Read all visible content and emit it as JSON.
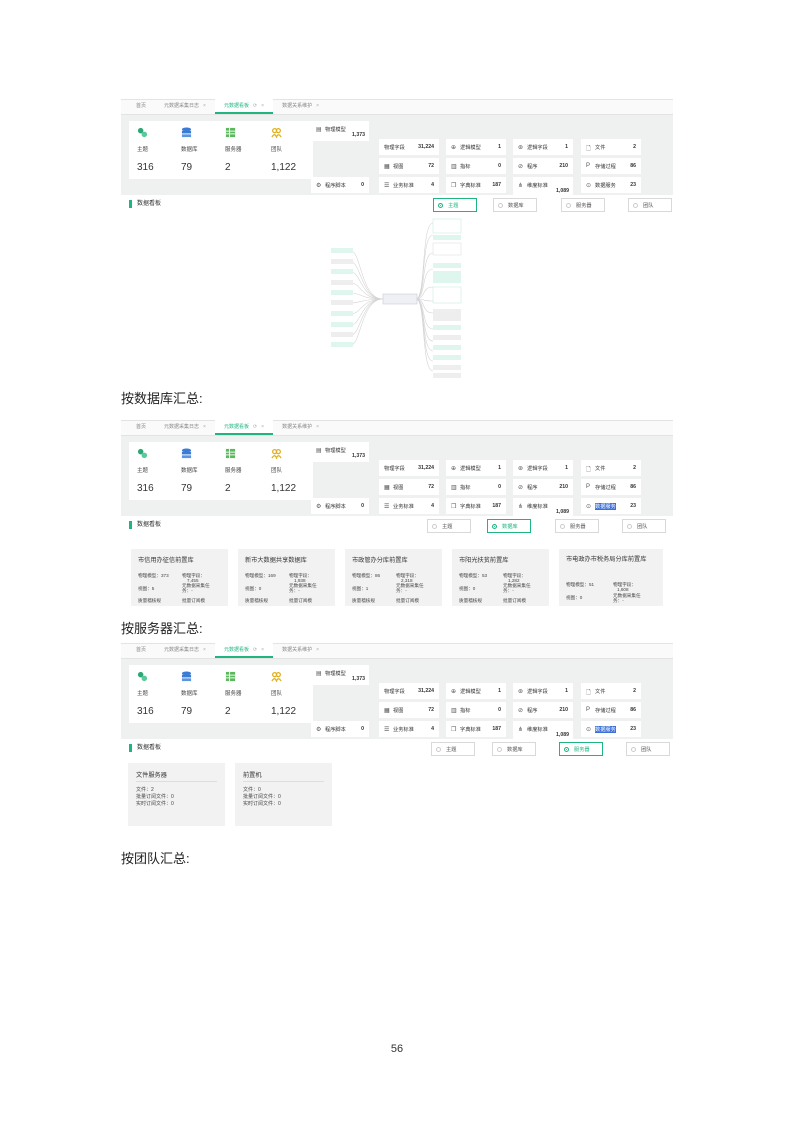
{
  "tabs": [
    {
      "label": "首页",
      "closable": false,
      "active": false
    },
    {
      "label": "元数据采集日志",
      "closable": true,
      "active": false
    },
    {
      "label": "元数据看板",
      "closable": true,
      "active": true
    },
    {
      "label": "数据关系维护",
      "closable": true,
      "active": false
    }
  ],
  "close_glyph": "×",
  "refresh_glyph": "⟳",
  "kpis": [
    {
      "label": "主题",
      "value": "316",
      "icon": "topic-icon",
      "color": "#2aa876"
    },
    {
      "label": "数据库",
      "value": "79",
      "icon": "database-icon",
      "color": "#3a7bd5"
    },
    {
      "label": "服务器",
      "value": "2",
      "icon": "server-icon",
      "color": "#5cb85c"
    },
    {
      "label": "团队",
      "value": "1,122",
      "icon": "team-icon",
      "color": "#e0b020"
    }
  ],
  "stats": {
    "physical_model": {
      "icon": "▤",
      "label": "物理模型",
      "value": "1,373"
    },
    "program_script": {
      "icon": "⚙",
      "label": "程序脚本",
      "value": "0"
    },
    "physical_field": {
      "label": "物理字段",
      "value": "31,224"
    },
    "view": {
      "icon": "▦",
      "label": "视图",
      "value": "72"
    },
    "business_std": {
      "icon": "☰",
      "label": "业务标准",
      "value": "4"
    },
    "logic_model": {
      "icon": "⊕",
      "label": "逻辑模型",
      "value": "1"
    },
    "metric": {
      "icon": "▥",
      "label": "指标",
      "value": "0"
    },
    "dict_std": {
      "icon": "❐",
      "label": "字典标准",
      "value": "187"
    },
    "logic_field": {
      "icon": "⊛",
      "label": "逻辑字段",
      "value": "1"
    },
    "program": {
      "icon": "⊘",
      "label": "程序",
      "value": "210"
    },
    "dimension_std": {
      "icon": "⋔",
      "label": "维度标准",
      "value": "1,089"
    },
    "file": {
      "icon": "🗋",
      "label": "文件",
      "value": "2"
    },
    "stored_proc": {
      "icon": "P",
      "label": "存储过程",
      "value": "86"
    },
    "data_service": {
      "icon": "⊙",
      "label": "数据服务",
      "value": "23"
    }
  },
  "board": {
    "title": "数据看板",
    "options": [
      "主题",
      "数据库",
      "服务器",
      "团队"
    ]
  },
  "screens": [
    {
      "selected": 0,
      "highlight_service": false
    },
    {
      "selected": 1,
      "highlight_service": true
    },
    {
      "selected": 2,
      "highlight_service": true
    }
  ],
  "captions": {
    "by_database": "按数据库汇总:",
    "by_server": "按服务器汇总:",
    "by_team": "按团队汇总:"
  },
  "db_cards": [
    {
      "name": "市信用办征信前置库",
      "model": "物理模型：373",
      "field_label": "物理字段：",
      "field_value": "7,455",
      "view": "视图：5",
      "collect": "元数据采集任",
      "collect2": "务：-",
      "q1": "质量稽核规",
      "q2": "批量订阅模"
    },
    {
      "name": "新市大数据共享数据库",
      "model": "物理模型：169",
      "field_label": "物理字段：",
      "field_value": "1,938",
      "view": "视图：0",
      "collect": "元数据采集任",
      "collect2": "务：-",
      "q1": "质量稽核规",
      "q2": "批量订阅模"
    },
    {
      "name": "市政管办分库前置库",
      "model": "物理模型：86",
      "field_label": "物理字段：",
      "field_value": "2,318",
      "view": "视图：1",
      "collect": "元数据采集任",
      "collect2": "务：-",
      "q1": "质量稽核规",
      "q2": "批量订阅模"
    },
    {
      "name": "市阳光扶贫前置库",
      "model": "物理模型：53",
      "field_label": "物理字段：",
      "field_value": "1,282",
      "view": "视图：0",
      "collect": "元数据采集任",
      "collect2": "务：-",
      "q1": "质量稽核规",
      "q2": "批量订阅模"
    },
    {
      "name": "市电政办市税务局分库前置库",
      "model": "物理模型：51",
      "field_label": "物理字段：",
      "field_value": "1,608",
      "view": "视图：0",
      "collect": "元数据采集任",
      "collect2": "务：-",
      "q1": "",
      "q2": ""
    }
  ],
  "servers": [
    {
      "name": "文件服务器",
      "files": "文件：2",
      "batch": "批量订阅文件：0",
      "realtime": "实时订阅文件：0"
    },
    {
      "name": "前置机",
      "files": "文件：0",
      "batch": "批量订阅文件：0",
      "realtime": "实时订阅文件：0"
    }
  ],
  "page_number": "56"
}
